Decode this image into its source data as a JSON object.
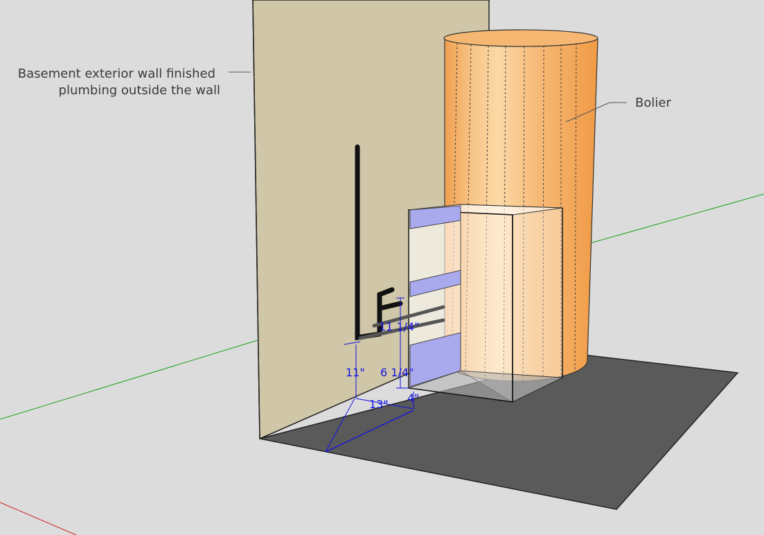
{
  "annotations": {
    "wall_line1": "Basement exterior wall finished",
    "wall_line2": "plumbing outside the wall",
    "boiler": "Bolier"
  },
  "dimensions": {
    "d1": "11 1/4\"",
    "d2": "6 1/4\"",
    "d3": "11\"",
    "d4": "13\"",
    "d5": "4\""
  },
  "colors": {
    "background": "#dcdcdc",
    "wall": "#d0c6a8",
    "floor": "#5a5a5a",
    "boiler": "#f2a65a",
    "cabinet_band": "#a9a9ee",
    "dimension": "#1010e0",
    "axis_green": "#1aa01a",
    "axis_red": "#d02020"
  }
}
